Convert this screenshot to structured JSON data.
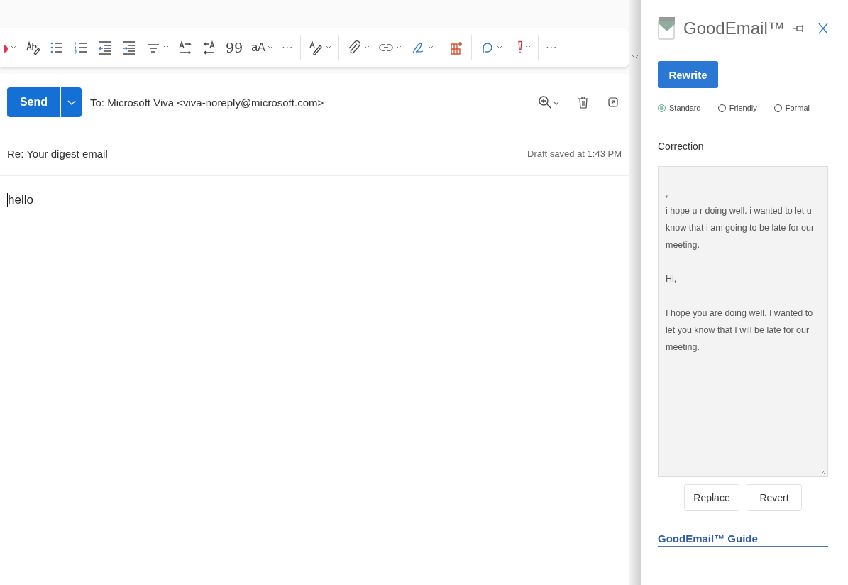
{
  "toolbar": [
    [
      {
        "kind": "font-color",
        "dropdown": true
      },
      {
        "kind": "spelling",
        "dropdown": false
      },
      {
        "kind": "bullets",
        "dropdown": false
      },
      {
        "kind": "numbering",
        "dropdown": false
      },
      {
        "kind": "outdent",
        "dropdown": false
      },
      {
        "kind": "indent",
        "dropdown": false
      },
      {
        "kind": "align",
        "dropdown": true
      },
      {
        "kind": "ltr",
        "dropdown": false
      },
      {
        "kind": "rtl",
        "dropdown": false
      },
      {
        "kind": "quote",
        "text": "99",
        "dropdown": false
      },
      {
        "kind": "case",
        "text": "aA",
        "dropdown": true
      },
      {
        "kind": "more",
        "text": "···",
        "dropdown": false
      }
    ],
    [
      {
        "kind": "styles",
        "dropdown": true
      }
    ],
    [
      {
        "kind": "attach",
        "dropdown": true
      },
      {
        "kind": "link",
        "dropdown": true
      },
      {
        "kind": "sign",
        "dropdown": true
      }
    ],
    [
      {
        "kind": "apps",
        "dropdown": false
      }
    ],
    [
      {
        "kind": "loop",
        "dropdown": true
      }
    ],
    [
      {
        "kind": "importance",
        "dropdown": true
      }
    ],
    [
      {
        "kind": "more",
        "text": "···",
        "dropdown": false
      }
    ]
  ],
  "compose": {
    "send": "Send",
    "to": "To:  Microsoft Viva <viva-noreply@microsoft.com>",
    "subject": "Re: Your digest email",
    "draft_status": "Draft saved at 1:43 PM",
    "body": "hello"
  },
  "addin": {
    "title": "GoodEmail™",
    "rewrite": "Rewrite",
    "tones": [
      {
        "label": "Standard",
        "selected": true
      },
      {
        "label": "Friendly",
        "selected": false
      },
      {
        "label": "Formal",
        "selected": false
      }
    ],
    "correction_label": "Correction",
    "correction": ",\ni hope u r doing well. i wanted to let u know that i am going to be late for our meeting.\n\nHi,\n\nI hope you are doing well. I wanted to let you know that I will be late for our meeting.",
    "buttons": [
      "Replace",
      "Revert"
    ],
    "guide": "GoodEmail™ Guide"
  }
}
